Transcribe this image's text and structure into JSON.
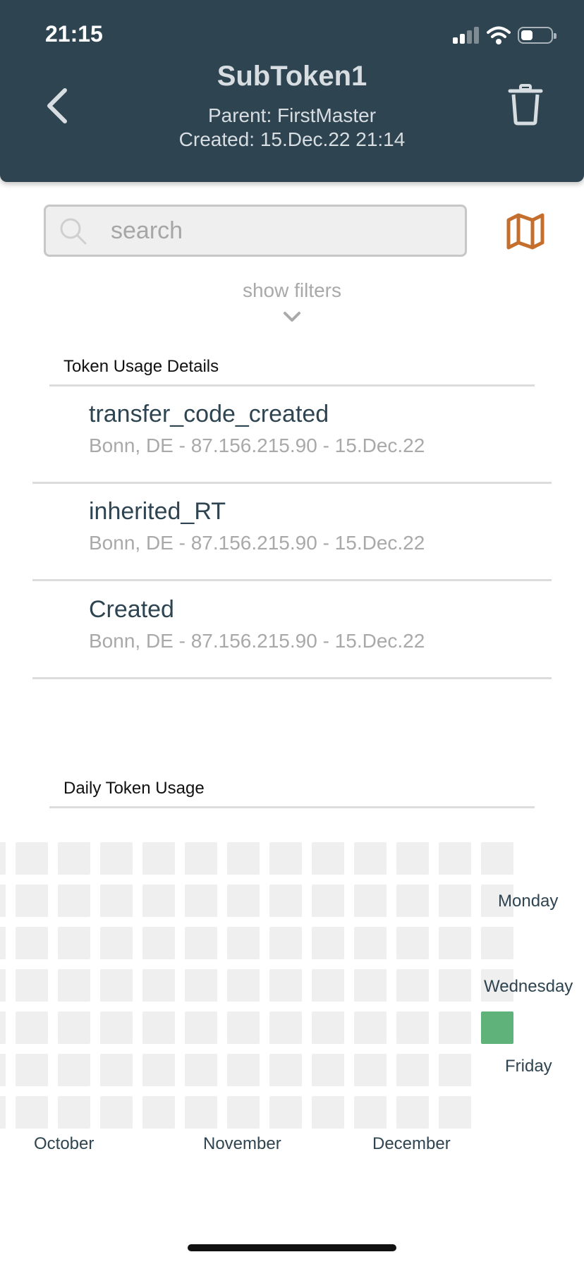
{
  "status_bar": {
    "time": "21:15"
  },
  "header": {
    "title": "SubToken1",
    "parent": "Parent: FirstMaster",
    "created": "Created: 15.Dec.22 21:14",
    "back_icon": "chevron-left-icon",
    "delete_icon": "trash-icon"
  },
  "search": {
    "placeholder": "search",
    "value": ""
  },
  "map_icon": "map-icon",
  "filters": {
    "label": "show filters"
  },
  "usage_details": {
    "heading": "Token Usage Details",
    "items": [
      {
        "event": "transfer_code_created",
        "meta": "Bonn, DE - 87.156.215.90 - 15.Dec.22"
      },
      {
        "event": "inherited_RT",
        "meta": "Bonn, DE - 87.156.215.90 - 15.Dec.22"
      },
      {
        "event": "Created",
        "meta": "Bonn, DE - 87.156.215.90 - 15.Dec.22"
      }
    ]
  },
  "daily_usage": {
    "heading": "Daily Token Usage",
    "days": [
      "Monday",
      "Wednesday",
      "Friday"
    ],
    "months": [
      "October",
      "November",
      "December"
    ],
    "active_day": {
      "week_index": 11,
      "weekday_index": 4,
      "level": 1
    },
    "colors": {
      "empty": "#efefef",
      "active": "#5fb27a"
    }
  },
  "colors": {
    "header_bg": "#2e4451",
    "accent": "#c46f2d"
  }
}
